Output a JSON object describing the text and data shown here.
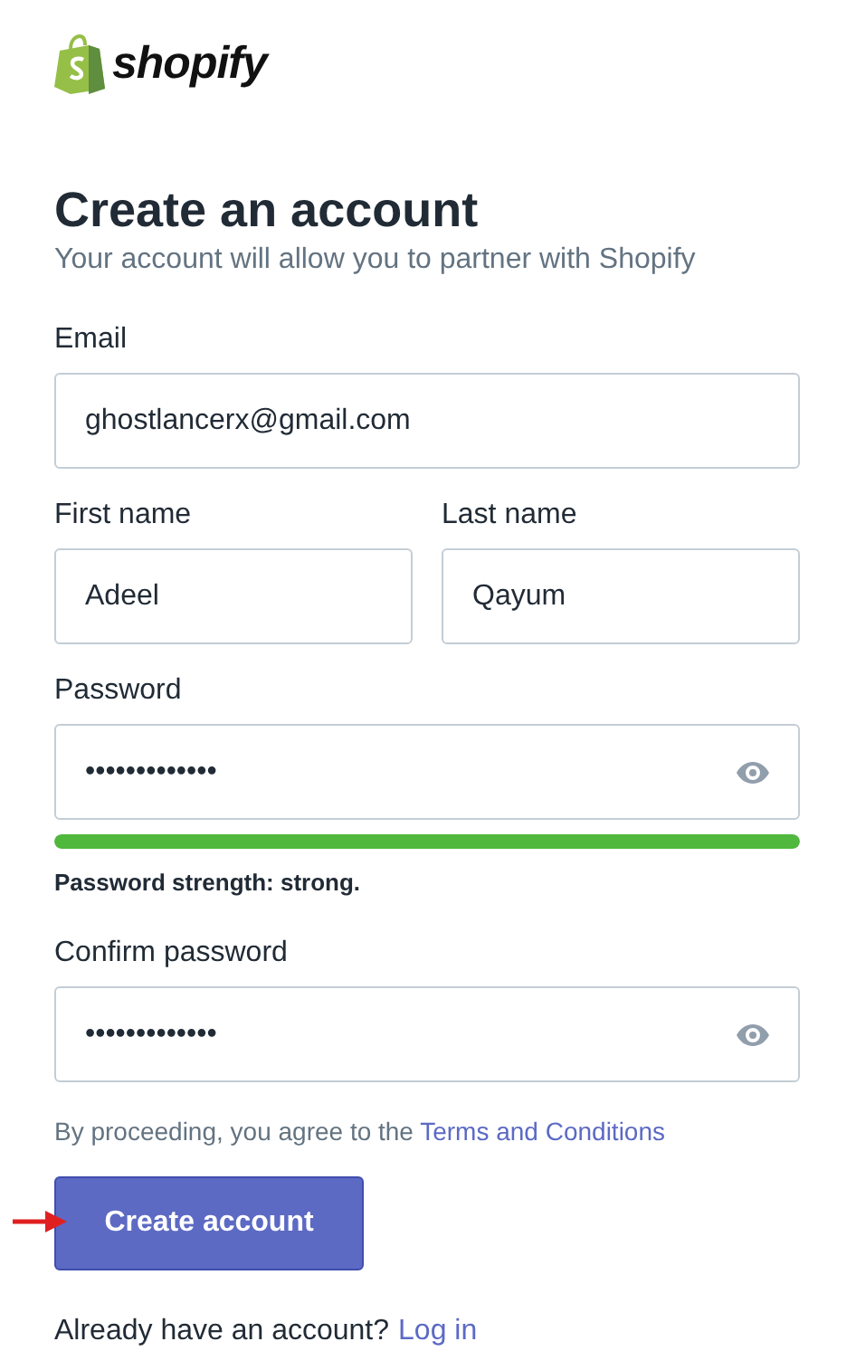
{
  "logo": {
    "wordmark": "shopify"
  },
  "heading": "Create an account",
  "subheading": "Your account will allow you to partner with Shopify",
  "fields": [
    {
      "label": "Email",
      "value": "ghostlancerx@gmail.com"
    }
  ],
  "name_fields": [
    {
      "label": "First name",
      "value": "Adeel"
    },
    {
      "label": "Last name",
      "value": "Qayum"
    }
  ],
  "password": {
    "label": "Password",
    "value": "•••••••••••••",
    "strength": {
      "level": 1,
      "text": "Password strength: strong."
    }
  },
  "confirm_password": {
    "label": "Confirm password",
    "value": "•••••••••••••"
  },
  "terms": {
    "text": "By proceeding, you agree to the ",
    "link": "Terms and Conditions"
  },
  "submit_button": "Create account",
  "login_prompt": {
    "text": "Already have an account?",
    "link": "Log in"
  }
}
